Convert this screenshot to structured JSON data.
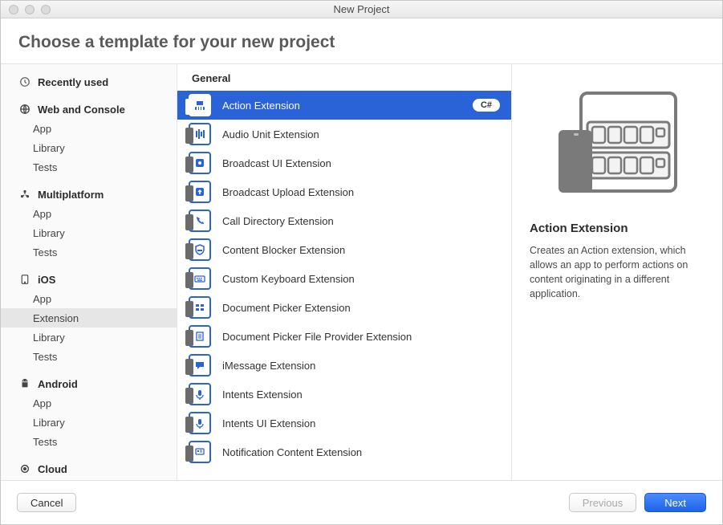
{
  "window_title": "New Project",
  "heading": "Choose a template for your new project",
  "sidebar": {
    "recent": {
      "label": "Recently used"
    },
    "categories": [
      {
        "label": "Web and Console",
        "items": [
          "App",
          "Library",
          "Tests"
        ]
      },
      {
        "label": "Multiplatform",
        "items": [
          "App",
          "Library",
          "Tests"
        ]
      },
      {
        "label": "iOS",
        "items": [
          "App",
          "Extension",
          "Library",
          "Tests"
        ],
        "selected": "Extension"
      },
      {
        "label": "Android",
        "items": [
          "App",
          "Library",
          "Tests"
        ]
      },
      {
        "label": "Cloud",
        "items": []
      }
    ]
  },
  "list": {
    "group": "General",
    "selected_index": 0,
    "badge": "C#",
    "templates": [
      "Action Extension",
      "Audio Unit Extension",
      "Broadcast UI Extension",
      "Broadcast Upload Extension",
      "Call Directory Extension",
      "Content Blocker Extension",
      "Custom Keyboard Extension",
      "Document Picker Extension",
      "Document Picker File Provider Extension",
      "iMessage Extension",
      "Intents Extension",
      "Intents UI Extension",
      "Notification Content Extension"
    ]
  },
  "detail": {
    "title": "Action Extension",
    "description": "Creates an Action extension, which allows an app to perform actions on content originating in a different application."
  },
  "footer": {
    "cancel": "Cancel",
    "previous": "Previous",
    "next": "Next"
  }
}
